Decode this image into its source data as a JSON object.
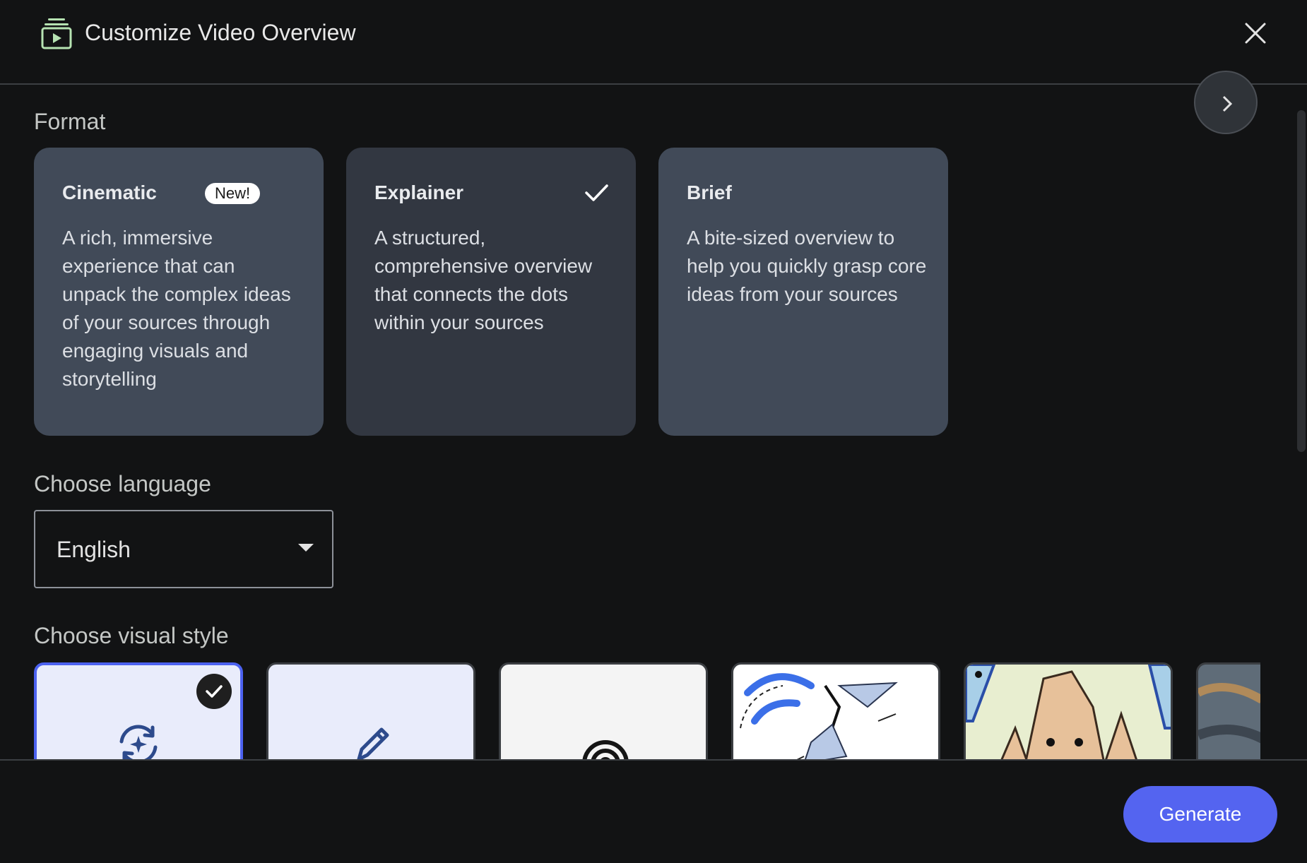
{
  "dialog": {
    "title": "Customize Video Overview"
  },
  "format": {
    "label": "Format",
    "cards": [
      {
        "title": "Cinematic",
        "badge": "New!",
        "description": "A rich, immersive experience that can unpack the complex ideas of your sources through engaging visuals and storytelling",
        "selected": false
      },
      {
        "title": "Explainer",
        "description": "A structured, comprehensive overview that connects the dots within your sources",
        "selected": true
      },
      {
        "title": "Brief",
        "description": "A bite-sized overview to help you quickly grasp core ideas from your sources",
        "selected": false
      }
    ]
  },
  "language": {
    "label": "Choose language",
    "value": "English"
  },
  "visual_style": {
    "label": "Choose visual style",
    "tiles": [
      {
        "icon": "auto-select-sparkle-icon",
        "selected": true
      },
      {
        "icon": "pencil-icon",
        "selected": false
      },
      {
        "icon": "rainbow-arcs-icon",
        "selected": false
      },
      {
        "icon": "sketch-illustration",
        "selected": false
      },
      {
        "icon": "cartoon-mountains-illustration",
        "selected": false
      },
      {
        "icon": "painted-landscape-illustration",
        "selected": false
      }
    ]
  },
  "footer": {
    "generate_label": "Generate"
  },
  "colors": {
    "accent": "#5464f0",
    "card": "#414a58",
    "card_selected": "#323741",
    "background": "#121314"
  }
}
